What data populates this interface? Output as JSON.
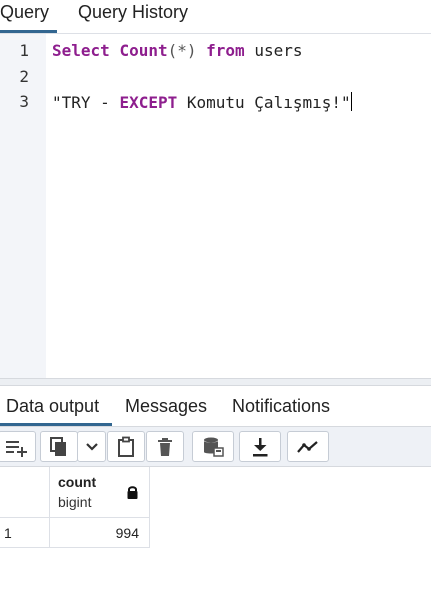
{
  "query_tabs": [
    {
      "label": "Query",
      "active": true
    },
    {
      "label": "Query History",
      "active": false
    }
  ],
  "editor": {
    "line_numbers": [
      "1",
      "2",
      "3"
    ],
    "line1": {
      "kw1": "Select",
      "kw2": "Count",
      "op": "(*)",
      "kw3": "from",
      "rest": "users"
    },
    "line3": {
      "str_start": "\"TRY - ",
      "kw": "EXCEPT",
      "str_end": " Komutu Çalışmış!\""
    }
  },
  "result_tabs": [
    {
      "label": "Data output",
      "active": true
    },
    {
      "label": "Messages",
      "active": false
    },
    {
      "label": "Notifications",
      "active": false
    }
  ],
  "toolbar_icons": [
    "add-row-icon",
    "copy-icon",
    "chevron-down-icon",
    "paste-icon",
    "delete-icon",
    "save-data-icon",
    "download-icon",
    "graph-icon"
  ],
  "grid": {
    "columns": [
      {
        "name": "count",
        "type": "bigint",
        "locked": true
      }
    ],
    "rows": [
      {
        "row_num": "1",
        "values": [
          "994"
        ]
      }
    ]
  },
  "colors": {
    "keyword": "#8e1e8e",
    "accent": "#326690",
    "gutter": "#f3f5f9",
    "toolbar": "#eef1f6"
  }
}
